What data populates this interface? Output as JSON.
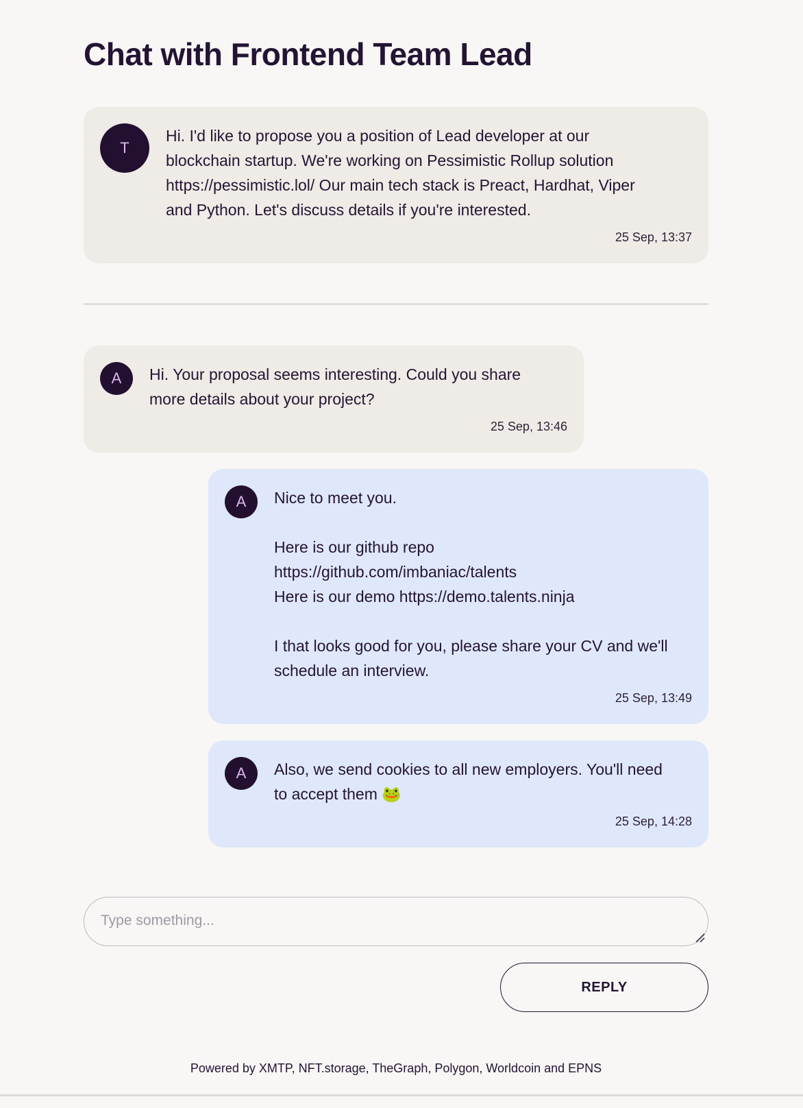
{
  "page": {
    "title": "Chat with Frontend Team Lead"
  },
  "messages": [
    {
      "avatar_letter": "T",
      "text": "Hi. I'd like to propose you a position of Lead developer at our\nblockchain startup. We're working on Pessimistic Rollup solution\nhttps://pessimistic.lol/ Our main tech stack is Preact, Hardhat, Viper\nand Python. Let's discuss details if you're interested.",
      "time": "25 Sep, 13:37"
    },
    {
      "avatar_letter": "A",
      "text": "Hi. Your proposal seems interesting. Could you share\nmore details about your project?",
      "time": "25 Sep, 13:46"
    },
    {
      "avatar_letter": "A",
      "text": "Nice to meet you.\n\nHere is our github repo\nhttps://github.com/imbaniac/talents\nHere is our demo https://demo.talents.ninja\n\nI that looks good for you, please share your CV and we'll\nschedule an interview.",
      "time": "25 Sep, 13:49"
    },
    {
      "avatar_letter": "A",
      "text": "Also, we send cookies to all new employers. You'll need\nto accept them 🐸",
      "time": "25 Sep, 14:28"
    }
  ],
  "composer": {
    "placeholder": "Type something..."
  },
  "reply_button": {
    "label": "REPLY"
  },
  "footer": {
    "text": "Powered by XMTP, NFT.storage, TheGraph, Polygon, Worldcoin and EPNS"
  },
  "colors": {
    "background": "#f8f7f5",
    "incoming_bubble": "#efebe6",
    "outgoing_bubble": "#dfe8fa",
    "avatar_bg": "#230f30",
    "avatar_letter": "#d9b8ec",
    "text": "#241433"
  }
}
